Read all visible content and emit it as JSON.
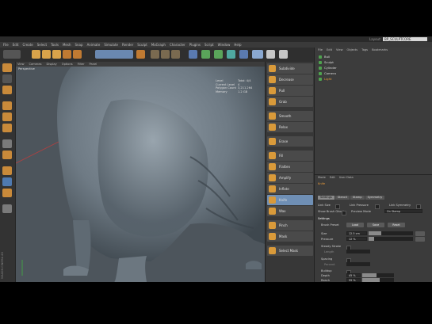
{
  "title_bar": {
    "layout_label": "Layout:",
    "layout_value": "BP_SCULPTCORE"
  },
  "menu": [
    "File",
    "Edit",
    "Create",
    "Select",
    "Tools",
    "Mesh",
    "Snap",
    "Animate",
    "Simulate",
    "Render",
    "Sculpt",
    "MoGraph",
    "Character",
    "Plugins",
    "Script",
    "Window",
    "Help"
  ],
  "viewport": {
    "menu": [
      "View",
      "Cameras",
      "Display",
      "Options",
      "Filter",
      "Panel"
    ],
    "label": "Perspective",
    "stats": [
      {
        "k": "Level",
        "v": "Total: 4/4"
      },
      {
        "k": "Current Level",
        "v": "4"
      },
      {
        "k": "Polygon Count",
        "v": "3,211,264"
      },
      {
        "k": "Memory",
        "v": "1.2 GB"
      }
    ]
  },
  "brushes": [
    "Subdivide",
    "Decrease",
    "Pull",
    "Grab",
    "Smooth",
    "Relax",
    "Erase",
    "Fill",
    "Flatten",
    "Amplify",
    "Inflate",
    "Knife",
    "Wax",
    "Pinch",
    "Mask",
    "Select Mask"
  ],
  "selected_brush": "Knife",
  "object_manager": {
    "menu": [
      "File",
      "Edit",
      "View",
      "Objects",
      "Tags",
      "Bookmarks"
    ],
    "rows": [
      "Bull",
      "Sculpt",
      "Cylinder",
      "Camera",
      "Light"
    ]
  },
  "attributes": {
    "menu": [
      "Mode",
      "Edit",
      "User Data"
    ],
    "title": "Knife",
    "tabs": [
      "Settings",
      "Stencil",
      "Stamp",
      "Symmetry"
    ],
    "labels": {
      "link_size": "Link Size",
      "link_pressure": "Link Pressure",
      "link_symmetry": "Link Symmetry",
      "show_brush": "Show Brush Ghost",
      "preview_mode": "Preview Mode",
      "preview_value": "On Stamp",
      "settings_head": "Settings",
      "brush_preset": "Brush Preset",
      "size": "Size",
      "pressure": "Pressure",
      "steady": "Steady Stroke",
      "length": "Length",
      "spacing": "Spacing",
      "percent": "Percent",
      "buildup": "Buildup",
      "depth": "Depth",
      "reach": "Reach"
    },
    "buttons": [
      "Load",
      "Save",
      "Reset"
    ],
    "values": {
      "size": "12.5 cm",
      "pressure": "12 %",
      "depth": "45 %",
      "reach": "55 %"
    },
    "levels": {
      "size": 0.28,
      "pressure": 0.12,
      "depth": 0.45,
      "reach": 0.55
    }
  },
  "left_brand": "MAXON CINEMA 4D"
}
